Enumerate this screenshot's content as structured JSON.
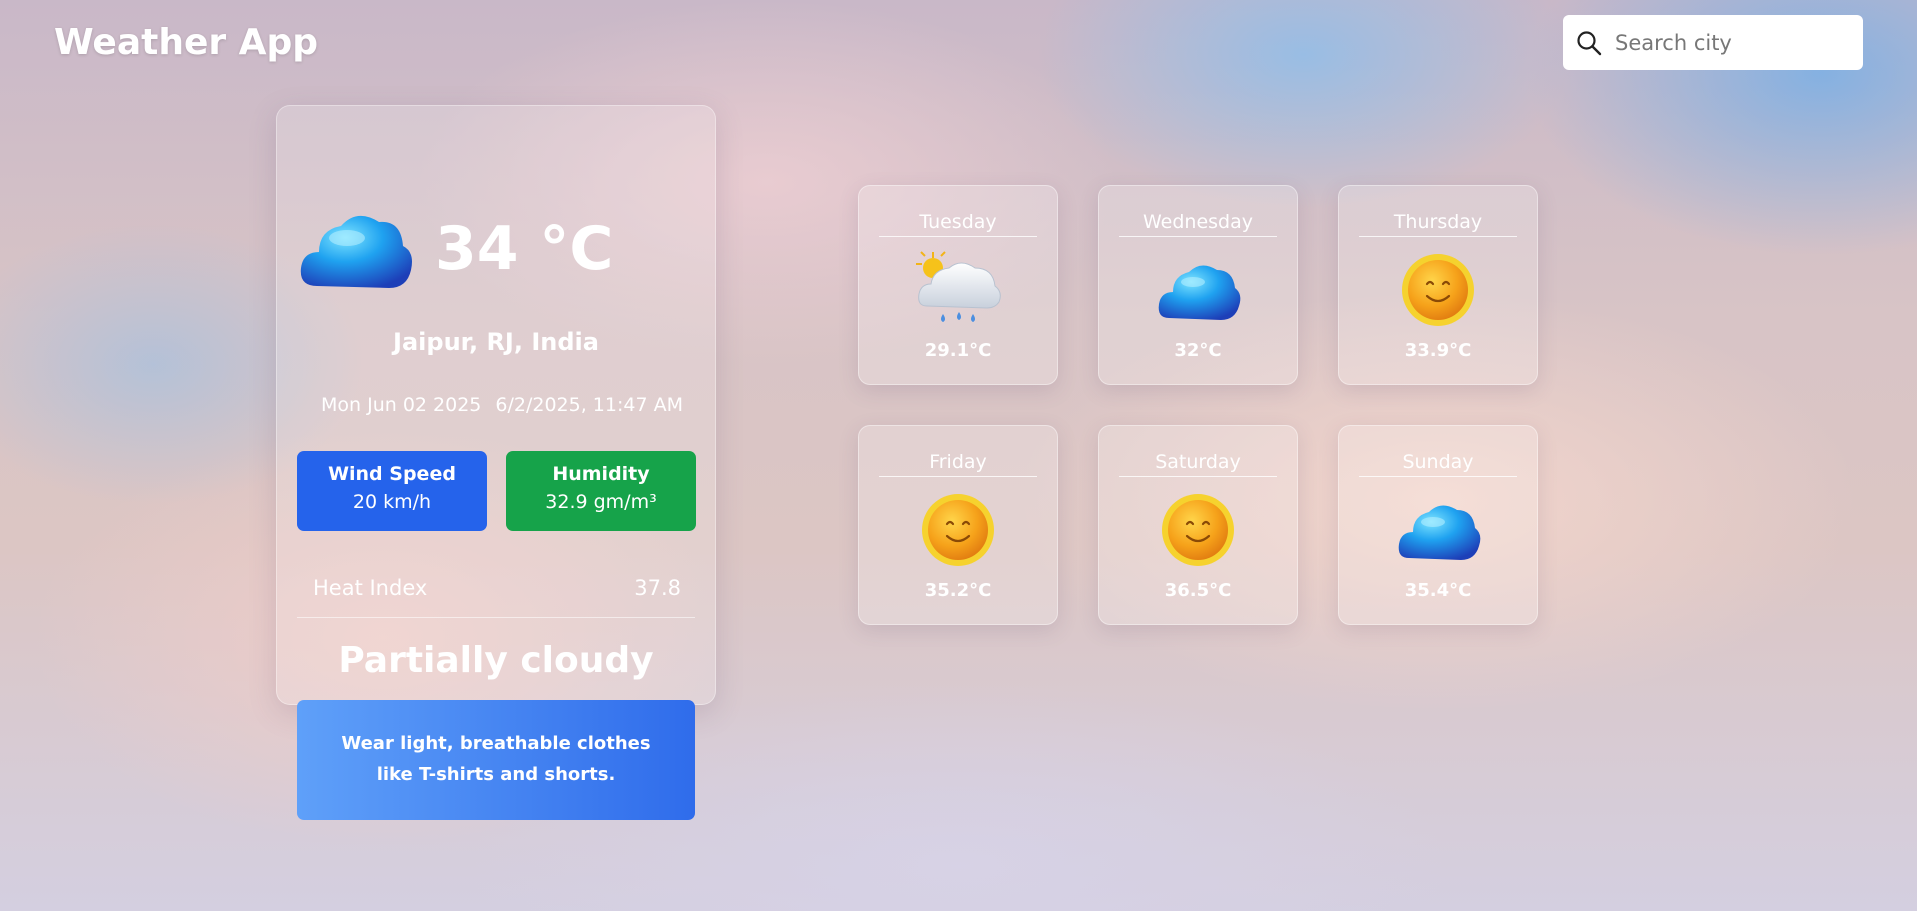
{
  "app": {
    "title": "Weather App"
  },
  "search": {
    "placeholder": "Search city"
  },
  "current": {
    "icon": "cloud-icon",
    "temperature": "34 °C",
    "location": "Jaipur, RJ, India",
    "date": "Mon Jun 02 2025",
    "datetime": "6/2/2025, 11:47 AM",
    "wind": {
      "label": "Wind Speed",
      "value": "20 km/h"
    },
    "humidity": {
      "label": "Humidity",
      "value": "32.9 gm/m³"
    },
    "heat_index": {
      "label": "Heat Index",
      "value": "37.8"
    },
    "condition": "Partially cloudy"
  },
  "tip": {
    "text": "Wear light, breathable clothes like T-shirts and shorts."
  },
  "forecast": [
    {
      "day": "Tuesday",
      "temp": "29.1°C",
      "icon": "rain-cloud-icon"
    },
    {
      "day": "Wednesday",
      "temp": "32°C",
      "icon": "cloud-icon"
    },
    {
      "day": "Thursday",
      "temp": "33.9°C",
      "icon": "sun-icon"
    },
    {
      "day": "Friday",
      "temp": "35.2°C",
      "icon": "sun-icon"
    },
    {
      "day": "Saturday",
      "temp": "36.5°C",
      "icon": "sun-icon"
    },
    {
      "day": "Sunday",
      "temp": "35.4°C",
      "icon": "cloud-icon"
    }
  ],
  "colors": {
    "wind": "#2563eb",
    "humidity": "#16a34a",
    "tip_start": "#5fa0f9",
    "tip_end": "#2f6ceb"
  }
}
